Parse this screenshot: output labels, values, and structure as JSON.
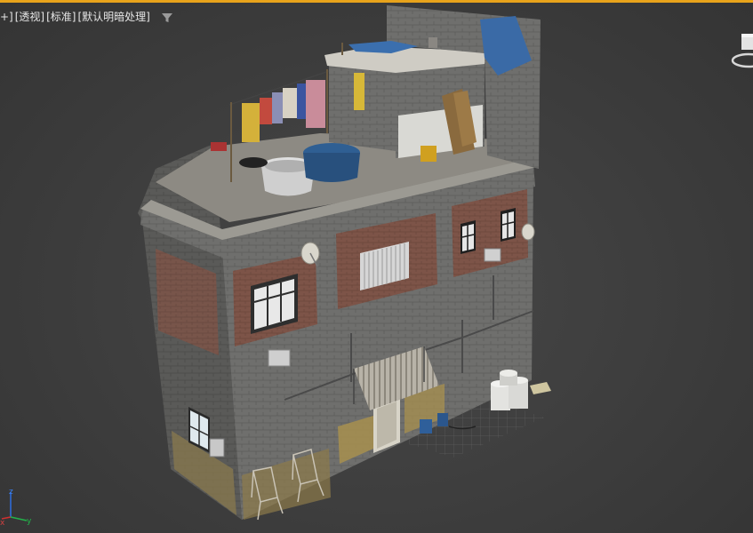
{
  "viewport": {
    "labels": [
      {
        "text": "+]"
      },
      {
        "text": "[透视]"
      },
      {
        "text": "[标准]"
      },
      {
        "text": "[默认明暗处理]"
      }
    ],
    "active_border_color": "#e8a31b",
    "background_color": "#3f3f3f",
    "icons": {
      "filter": "filter-icon",
      "viewcube": "viewcube-icon",
      "axis": "xyz-axis-gizmo-icon"
    },
    "axis_labels": {
      "z": "z",
      "x": "x",
      "y": "y"
    }
  }
}
